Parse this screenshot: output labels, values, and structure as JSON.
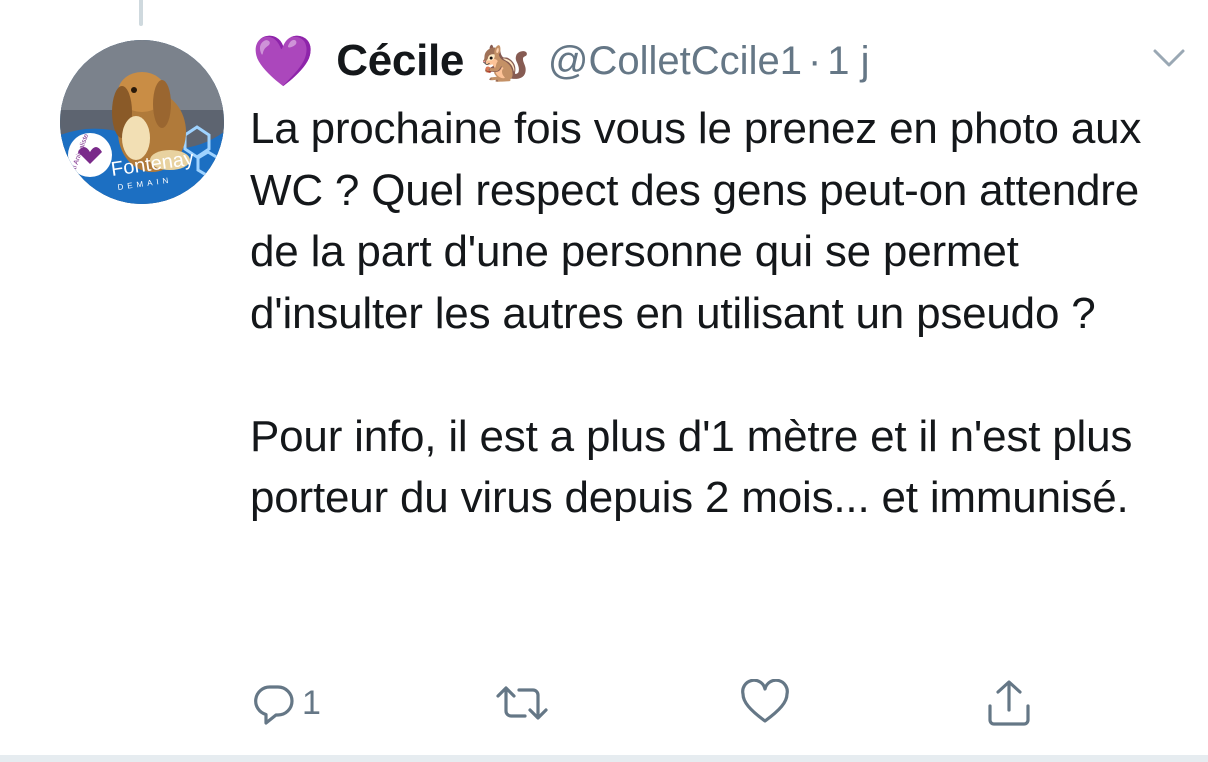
{
  "tweet": {
    "user": {
      "emoji_before_name": "💜",
      "name": "Cécile",
      "emoji_after_name": "🐿️",
      "handle": "@ColletCcile1",
      "separator": "·",
      "time": "1 j",
      "avatar_text": "Fontenay",
      "avatar_subtext": "DEMAIN",
      "avatar_badge": "Parti Animaliste"
    },
    "text_paragraphs": [
      "La prochaine fois vous le prenez en photo aux WC ? Quel respect des gens peut-on attendre de la part d'une personne qui se permet d'insulter les autres en utilisant un pseudo ?",
      "Pour info, il est a plus d'1 mètre et il n'est plus porteur du virus depuis 2 mois... et immunisé."
    ],
    "actions": {
      "reply_count": "1"
    },
    "colors": {
      "text": "#14171a",
      "secondary": "#657786",
      "divider": "#e6ecf0",
      "icon": "#657786"
    },
    "icons": {
      "menu": "chevron-down-icon",
      "reply": "reply-icon",
      "retweet": "retweet-icon",
      "like": "heart-icon",
      "share": "share-icon"
    }
  }
}
